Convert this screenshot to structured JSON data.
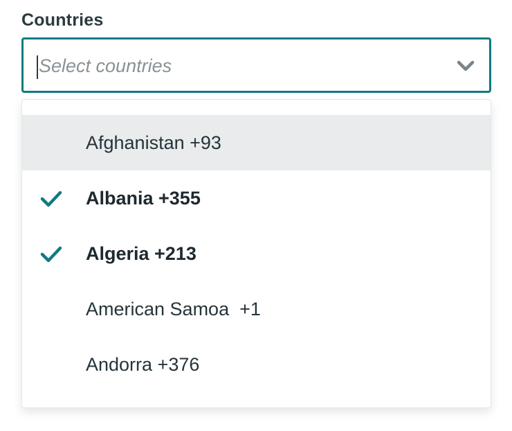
{
  "field": {
    "label": "Countries",
    "placeholder": "Select countries",
    "value": ""
  },
  "colors": {
    "accent": "#107a82",
    "highlight": "#e9ebec",
    "text": "#26343a"
  },
  "options": [
    {
      "label": "Afghanistan +93",
      "selected": false,
      "highlighted": true
    },
    {
      "label": "Albania +355",
      "selected": true,
      "highlighted": false
    },
    {
      "label": "Algeria +213",
      "selected": true,
      "highlighted": false
    },
    {
      "label": "American Samoa  +1",
      "selected": false,
      "highlighted": false
    },
    {
      "label": "Andorra +376",
      "selected": false,
      "highlighted": false
    }
  ]
}
